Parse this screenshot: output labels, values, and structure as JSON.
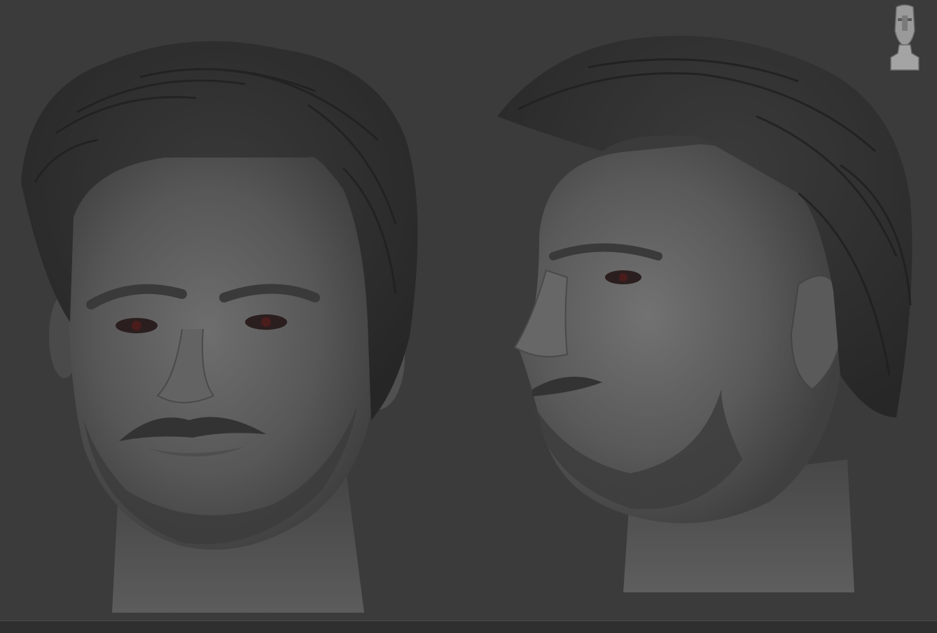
{
  "app": {
    "viewport_background": "#3b3b3b",
    "material_color": "#5a5a5a",
    "hair_color": "#2f2f2f"
  },
  "viewport": {
    "models": [
      {
        "view": "front-three-quarter",
        "icon": "sculpted-head-front"
      },
      {
        "view": "side-three-quarter",
        "icon": "sculpted-head-side"
      }
    ],
    "navigation_gizmo": {
      "icon": "head-navigation-gizmo-icon"
    }
  }
}
